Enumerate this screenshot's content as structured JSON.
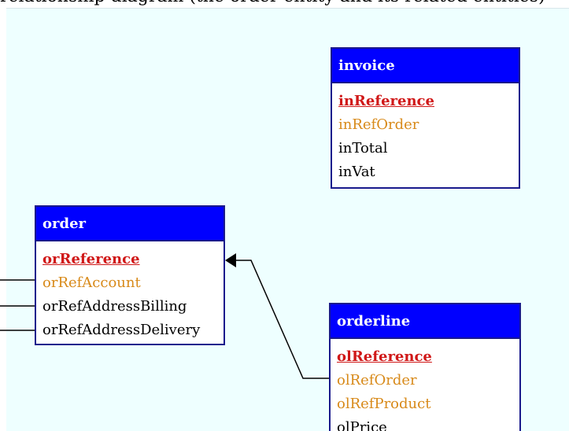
{
  "header": {
    "caption": "relationship diagram (the order entity and its related entities)"
  },
  "colors": {
    "canvas_background": "#eeffff",
    "entity_header": "#0000ff",
    "entity_border": "#1a1a8c",
    "primary_key": "#d01818",
    "foreign_key": "#d88a1a",
    "field_text": "#000000"
  },
  "entities": {
    "invoice": {
      "name": "invoice",
      "fields": [
        {
          "label": "inReference",
          "kind": "primary-key"
        },
        {
          "label": "inRefOrder",
          "kind": "foreign-key"
        },
        {
          "label": "inTotal",
          "kind": "attribute"
        },
        {
          "label": "inVat",
          "kind": "attribute"
        }
      ]
    },
    "order": {
      "name": "order",
      "fields": [
        {
          "label": "orReference",
          "kind": "primary-key"
        },
        {
          "label": "orRefAccount",
          "kind": "foreign-key"
        },
        {
          "label": "orRefAddressBilling",
          "kind": "attribute"
        },
        {
          "label": "orRefAddressDelivery",
          "kind": "attribute"
        }
      ]
    },
    "orderline": {
      "name": "orderline",
      "fields": [
        {
          "label": "olReference",
          "kind": "primary-key"
        },
        {
          "label": "olRefOrder",
          "kind": "foreign-key"
        },
        {
          "label": "olRefProduct",
          "kind": "foreign-key"
        },
        {
          "label": "olPrice",
          "kind": "attribute"
        }
      ]
    }
  },
  "relationships": [
    {
      "from": "orderline.olRefOrder",
      "to": "order",
      "arrow": "filled"
    }
  ],
  "icons": {
    "relationship_arrow": "arrowhead-icon"
  }
}
